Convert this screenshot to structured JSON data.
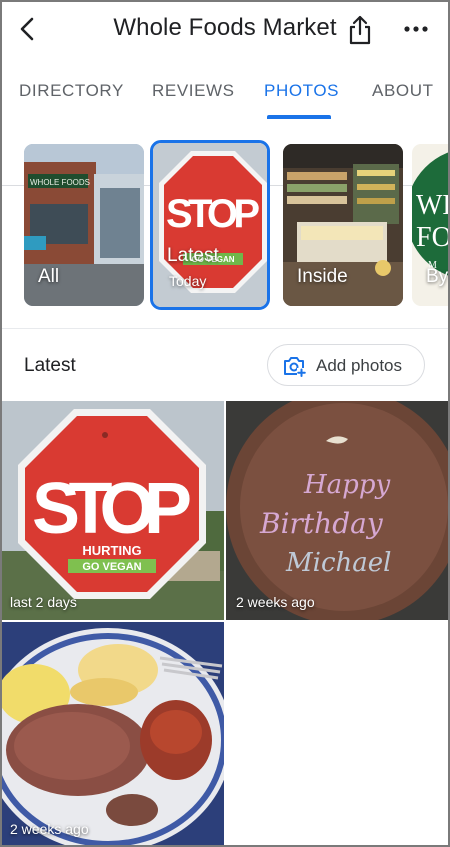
{
  "header": {
    "title": "Whole Foods Market",
    "back_icon": "chevron-left-icon",
    "share_icon": "share-icon",
    "more_icon": "more-horizontal-icon"
  },
  "tabs": [
    {
      "label": "DIRECTORY",
      "active": false
    },
    {
      "label": "REVIEWS",
      "active": false
    },
    {
      "label": "PHOTOS",
      "active": true
    },
    {
      "label": "ABOUT",
      "active": false
    }
  ],
  "photo_categories": [
    {
      "label": "All",
      "sub": ""
    },
    {
      "label": "Latest",
      "sub": "Today",
      "selected": true
    },
    {
      "label": "Inside",
      "sub": ""
    },
    {
      "label": "By",
      "sub": ""
    }
  ],
  "photo_text": {
    "stop_sign": "STOP",
    "stop_small_a": "HURTING",
    "stop_small_b": "GO VEGAN",
    "store_sign": "WHOLE FOODS",
    "logo_a": "WH",
    "logo_b": "FO",
    "logo_c": "M",
    "cake_1": "Happy",
    "cake_2": "Birthday",
    "cake_3": "Michael"
  },
  "latest_section": {
    "heading": "Latest",
    "add_button_label": "Add photos",
    "add_button_icon": "add-photo-camera-icon"
  },
  "photos": [
    {
      "caption": "last 2 days",
      "subject": "stop-sign"
    },
    {
      "caption": "2 weeks ago",
      "subject": "birthday-cake"
    },
    {
      "caption": "2 weeks ago",
      "subject": "steak-plate"
    }
  ],
  "colors": {
    "accent": "#1a73e8",
    "text": "#202124",
    "muted": "#5f6368",
    "stop_red": "#d93a32"
  }
}
